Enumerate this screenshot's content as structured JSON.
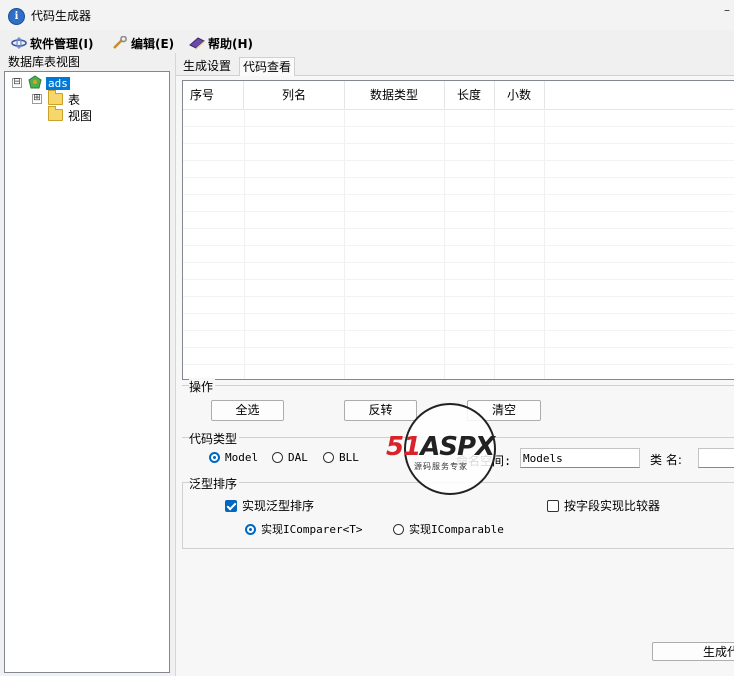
{
  "window": {
    "title": "代码生成器",
    "icon": "info-icon",
    "minimize": "–"
  },
  "menubar": [
    {
      "label": "软件管理(I)",
      "icon": "software-icon"
    },
    {
      "label": "编辑(E)",
      "icon": "wrench-icon"
    },
    {
      "label": "帮助(H)",
      "icon": "help-book-icon"
    }
  ],
  "tree": {
    "label": "数据库表视图",
    "root": {
      "label": "ads",
      "expander": "⊟",
      "icon": "database-icon"
    },
    "children": [
      {
        "label": "表",
        "expander": "⊞",
        "icon": "folder-icon"
      },
      {
        "label": "视图",
        "icon": "folder-icon"
      }
    ]
  },
  "tabs": [
    {
      "label": "生成设置",
      "active": false
    },
    {
      "label": "代码查看",
      "active": true
    }
  ],
  "grid": {
    "columns": [
      "序号",
      "列名",
      "数据类型",
      "长度",
      "小数"
    ],
    "rows": []
  },
  "operations": {
    "label": "操作",
    "buttons": [
      "全选",
      "反转",
      "清空"
    ]
  },
  "code_type": {
    "label": "代码类型",
    "options": [
      "Model",
      "DAL",
      "BLL"
    ],
    "selected": "Model",
    "namespace_label": "命名空间:",
    "namespace_value": "Models",
    "class_label": "类 名:",
    "class_value": ""
  },
  "generic_sort": {
    "label": "泛型排序",
    "implement_generic_sort": {
      "label": "实现泛型排序",
      "checked": true
    },
    "field_comparer": {
      "label": "按字段实现比较器",
      "checked": false
    },
    "options": [
      "实现IComparer<T>",
      "实现IComparable"
    ],
    "selected": "实现IComparer<T>"
  },
  "generate_button": "生成代码",
  "watermark": {
    "main_red": "51",
    "main_dark": "ASPX",
    "sub": "源码服务专家"
  },
  "colors": {
    "accent": "#0067c0",
    "selection": "#0078d7",
    "watermark_red": "#d8232a",
    "watermark_green": "#3a9b35"
  }
}
